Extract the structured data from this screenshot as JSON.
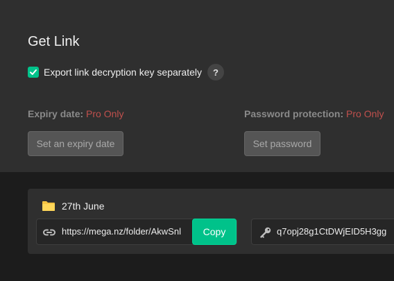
{
  "dialog": {
    "title": "Get Link",
    "export_key": {
      "label": "Export link decryption key separately",
      "checked": true,
      "help_glyph": "?"
    }
  },
  "expiry": {
    "label": "Expiry date:",
    "pro_label": "Pro Only",
    "button_label": "Set an expiry date"
  },
  "password": {
    "label": "Password protection:",
    "pro_label": "Pro Only",
    "button_label": "Set password"
  },
  "item": {
    "icon": "folder-icon",
    "name": "27th June",
    "link_icon": "link-icon",
    "link": "https://mega.nz/folder/AkwSnl",
    "copy_label": "Copy",
    "key_icon": "key-icon",
    "key": "q7opj28g1CtDWjEID5H3gg"
  },
  "colors": {
    "accent": "#00c28a",
    "pro": "#c0504d",
    "panel": "#2f2f2f",
    "background": "#1c1c1c"
  }
}
